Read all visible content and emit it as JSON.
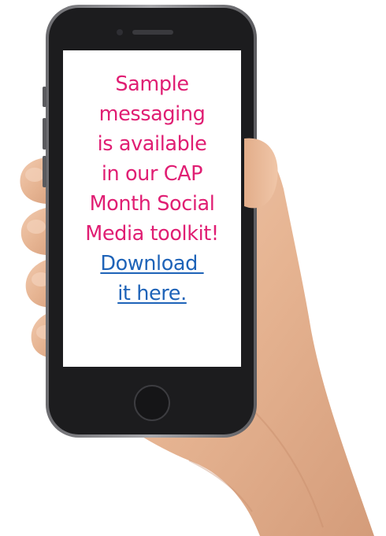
{
  "message": {
    "lines": [
      "Sample",
      "messaging",
      "is available",
      "in our CAP",
      "Month Social",
      "Media toolkit!"
    ],
    "link_lines": [
      "Download ",
      "it here."
    ]
  },
  "colors": {
    "message_text": "#e01e73",
    "link_text": "#1e63b8",
    "phone_body": "#1c1c1e",
    "phone_frame": "#8a8a8e",
    "screen": "#ffffff",
    "skin": "#e6b896",
    "background": "#ffffff"
  },
  "icons": {
    "phone": "smartphone",
    "hand": "hand-holding"
  }
}
